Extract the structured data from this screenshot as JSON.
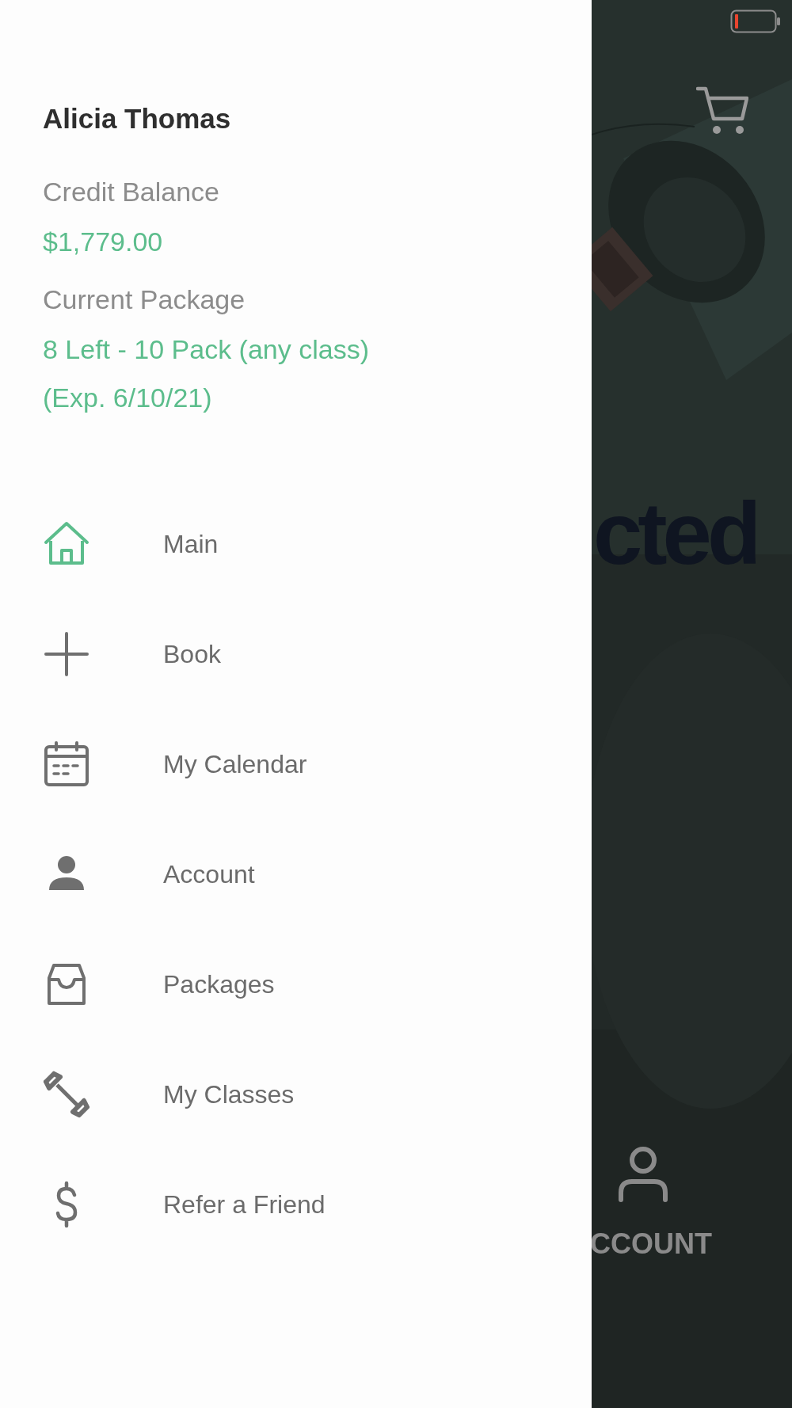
{
  "drawer": {
    "user_name": "Alicia Thomas",
    "credit": {
      "label": "Credit Balance",
      "value": "$1,779.00"
    },
    "package": {
      "label": "Current Package",
      "lines": [
        "8 Left - 10 Pack (any class)",
        "(Exp. 6/10/21)"
      ]
    },
    "menu": [
      {
        "kind": "home",
        "label": "Main",
        "selected": true
      },
      {
        "kind": "plus",
        "label": "Book",
        "selected": false
      },
      {
        "kind": "calendar",
        "label": "My Calendar",
        "selected": false
      },
      {
        "kind": "person",
        "label": "Account",
        "selected": false
      },
      {
        "kind": "inbox",
        "label": "Packages",
        "selected": false
      },
      {
        "kind": "dumbbell",
        "label": "My Classes",
        "selected": false
      },
      {
        "kind": "dollar",
        "label": "Refer a Friend",
        "selected": false
      }
    ]
  },
  "background": {
    "logo_text": "cted",
    "tab_label": "CCOUNT"
  }
}
